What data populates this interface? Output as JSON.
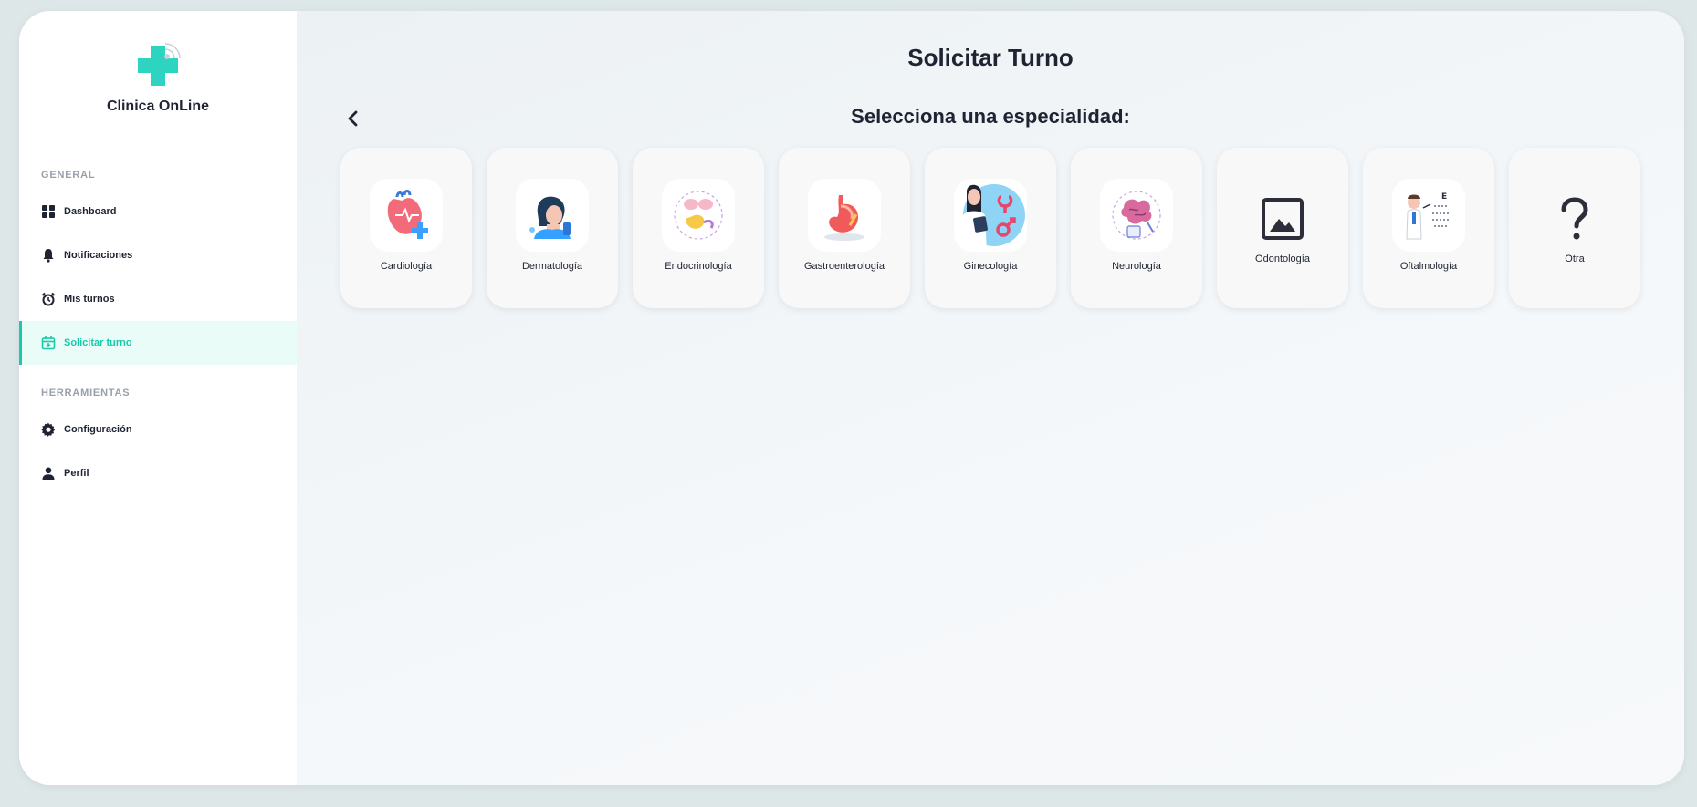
{
  "brand": {
    "name": "Clinica OnLine",
    "icon": "medical-cross-logo"
  },
  "sidebar": {
    "general_title": "GENERAL",
    "tools_title": "HERRAMIENTAS",
    "items": [
      {
        "label": "Dashboard",
        "icon": "dashboard-icon"
      },
      {
        "label": "Notificaciones",
        "icon": "bell-icon"
      },
      {
        "label": "Mis turnos",
        "icon": "alarm-clock-icon"
      },
      {
        "label": "Solicitar turno",
        "icon": "calendar-plus-icon",
        "active": true
      },
      {
        "label": "Configuración",
        "icon": "gear-icon"
      },
      {
        "label": "Perfil",
        "icon": "user-icon"
      }
    ]
  },
  "main": {
    "title": "Solicitar Turno",
    "subtitle": "Selecciona una especialidad:",
    "back_icon": "chevron-left-icon",
    "specialties": [
      {
        "label": "Cardiología",
        "icon": "heart-illustration"
      },
      {
        "label": "Dermatología",
        "icon": "skin-care-illustration"
      },
      {
        "label": "Endocrinología",
        "icon": "endocrine-glands-illustration"
      },
      {
        "label": "Gastroenterología",
        "icon": "stomach-illustration"
      },
      {
        "label": "Ginecología",
        "icon": "gynecologist-illustration"
      },
      {
        "label": "Neurología",
        "icon": "brain-illustration"
      },
      {
        "label": "Odontología",
        "icon": "image-placeholder-icon"
      },
      {
        "label": "Oftalmología",
        "icon": "eye-chart-doctor-illustration"
      },
      {
        "label": "Otra",
        "icon": "question-mark-icon"
      }
    ]
  },
  "colors": {
    "accent": "#19c9ab",
    "active_bg": "#eafcf8",
    "text": "#1f2433",
    "muted": "#9aa0ab"
  }
}
